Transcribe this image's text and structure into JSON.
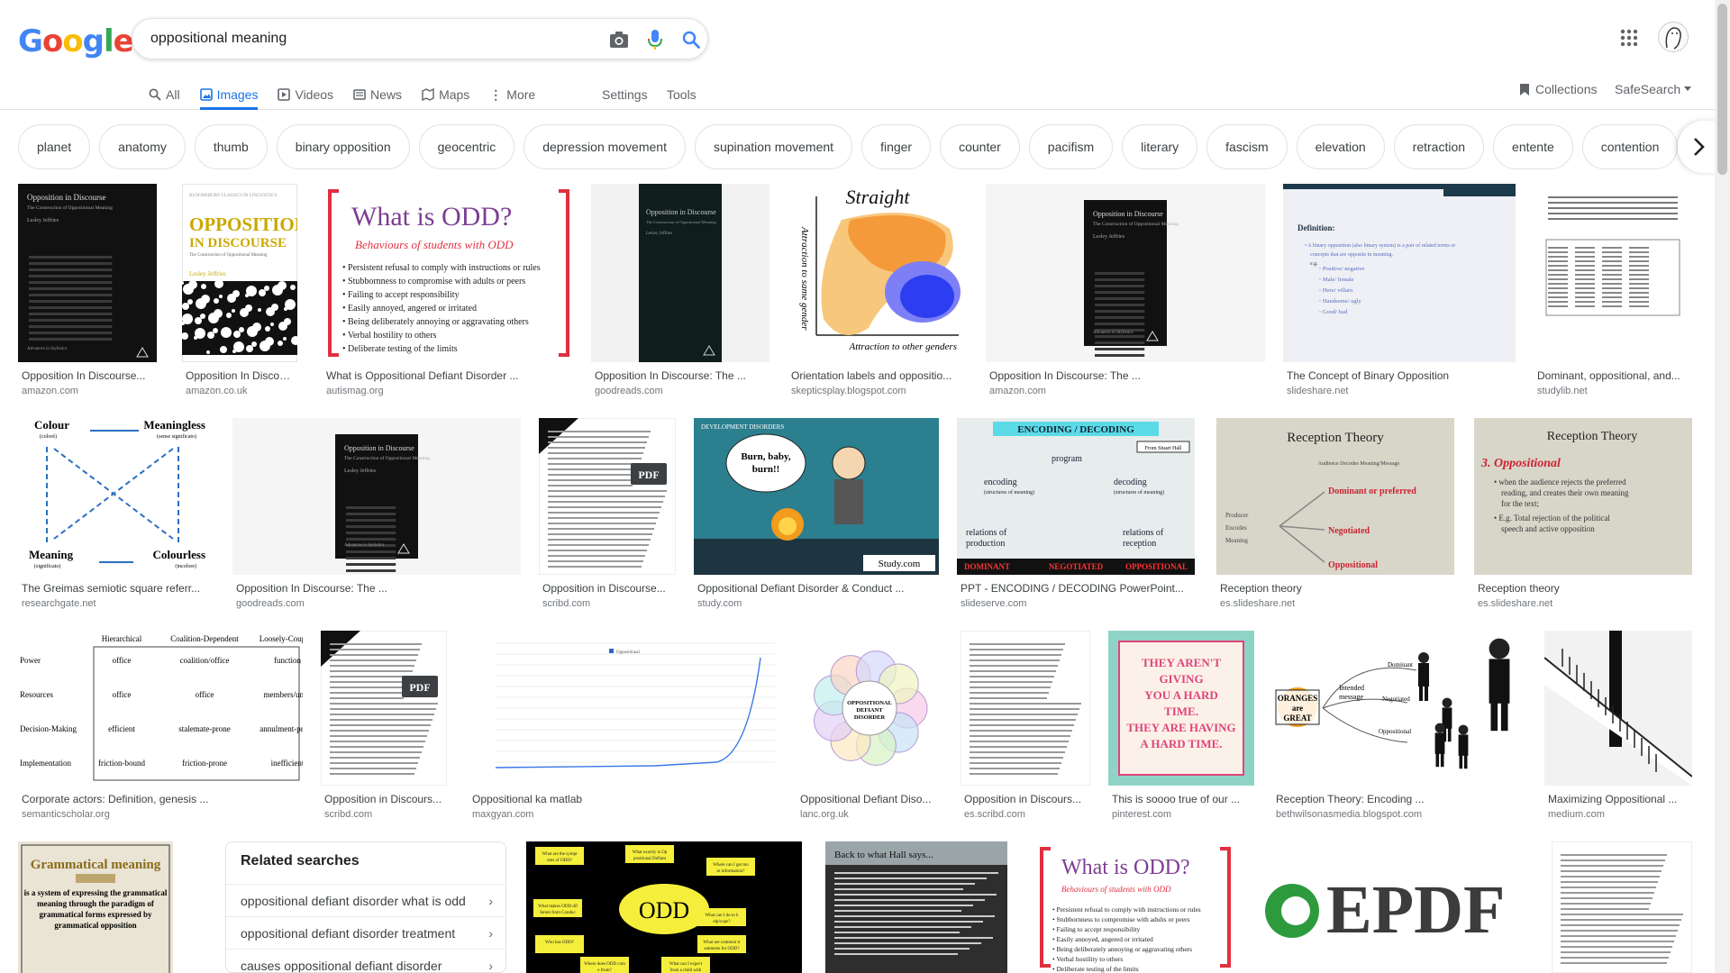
{
  "logo_letters": [
    {
      "ch": "G",
      "color": "#4285F4"
    },
    {
      "ch": "o",
      "color": "#EA4335"
    },
    {
      "ch": "o",
      "color": "#FBBC05"
    },
    {
      "ch": "g",
      "color": "#4285F4"
    },
    {
      "ch": "l",
      "color": "#34A853"
    },
    {
      "ch": "e",
      "color": "#EA4335"
    }
  ],
  "search": {
    "query": "oppositional meaning"
  },
  "tabs": {
    "all": "All",
    "images": "Images",
    "videos": "Videos",
    "news": "News",
    "maps": "Maps",
    "more": "More",
    "settings": "Settings",
    "tools": "Tools"
  },
  "right_nav": {
    "collections": "Collections",
    "safesearch": "SafeSearch"
  },
  "chips": [
    "planet",
    "anatomy",
    "thumb",
    "binary opposition",
    "geocentric",
    "depression movement",
    "supination movement",
    "finger",
    "counter",
    "pacifism",
    "literary",
    "fascism",
    "elevation",
    "retraction",
    "entente",
    "contention"
  ],
  "results": [
    {
      "title": "Opposition In Discourse...",
      "source": "amazon.com"
    },
    {
      "title": "Opposition In Discour...",
      "source": "amazon.co.uk"
    },
    {
      "title": "What is Oppositional Defiant Disorder ...",
      "source": "autismag.org"
    },
    {
      "title": "Opposition In Discourse: The ...",
      "source": "goodreads.com"
    },
    {
      "title": "Orientation labels and oppositio...",
      "source": "skepticsplay.blogspot.com"
    },
    {
      "title": "Opposition In Discourse: The ...",
      "source": "amazon.com"
    },
    {
      "title": "The Concept of Binary Opposition",
      "source": "slideshare.net"
    },
    {
      "title": "Dominant, oppositional, and...",
      "source": "studylib.net"
    },
    {
      "title": "The Greimas semiotic square referr...",
      "source": "researchgate.net"
    },
    {
      "title": "Opposition In Discourse: The ...",
      "source": "goodreads.com"
    },
    {
      "title": "Opposition in Discourse...",
      "source": "scribd.com"
    },
    {
      "title": "Oppositional Defiant Disorder & Conduct ...",
      "source": "study.com"
    },
    {
      "title": "PPT - ENCODING / DECODING PowerPoint...",
      "source": "slideserve.com"
    },
    {
      "title": "Reception theory",
      "source": "es.slideshare.net"
    },
    {
      "title": "Reception theory",
      "source": "es.slideshare.net"
    },
    {
      "title": "Corporate actors: Definition, genesis ...",
      "source": "semanticscholar.org"
    },
    {
      "title": "Opposition in Discours...",
      "source": "scribd.com"
    },
    {
      "title": "Oppositional ka matlab",
      "source": "maxgyan.com"
    },
    {
      "title": "Oppositional Defiant Diso...",
      "source": "lanc.org.uk"
    },
    {
      "title": "Opposition in Discours...",
      "source": "es.scribd.com"
    },
    {
      "title": "This is soooo true of our ...",
      "source": "pinterest.com"
    },
    {
      "title": "Reception Theory: Encoding ...",
      "source": "bethwilsonasmedia.blogspot.com"
    },
    {
      "title": "Maximizing Oppositional ...",
      "source": "medium.com"
    }
  ],
  "thumb_text": {
    "book_title": "Opposition in Discourse",
    "book_subtitle": "The Construction of Oppositional Meaning",
    "book_author": "Lesley Jeffries",
    "book_series": "Advances in Stylistics",
    "book2_series": "BLOOMSBURY CLASSICS IN LINGUISTICS",
    "book2_t1": "OPPOSITION",
    "book2_t2": "IN DISCOURSE",
    "book2_sub": "The Construction of Oppositional Meaning",
    "book2_author": "Lesley Jeffries",
    "odd_title": "What is ODD?",
    "odd_sub": "Behaviours of students with ODD",
    "odd_items": [
      "Persistent refusal to comply with instructions or rules",
      "Stubbornness to compromise with adults or peers",
      "Failing to accept responsibility",
      "Easily annoyed, angered or irritated",
      "Being deliberately annoying or aggravating others",
      "Verbal hostility to others",
      "Deliberate testing of the limits"
    ],
    "straight": "Straight",
    "attr_same": "Attraction to same gender",
    "attr_other": "Attraction to other genders",
    "definition": "Definition:",
    "def_text": "A binary opposition (also binary system) is a pair of related terms or concepts that are opposite in meaning.",
    "def_eg": "e.g.",
    "def_pairs": [
      "Positive/ negative",
      "Male/ female",
      "Hero/ villain",
      "Handsome/ ugly",
      "Good/ bad"
    ],
    "colour": "Colour",
    "colour_sub": "(coloré)",
    "meaningless": "Meaningless",
    "meaningless_sub": "(sense significato)",
    "meaning": "Meaning",
    "meaning_sub": "(significato)",
    "colourless": "Colourless",
    "colourless_sub": "(incolore)",
    "pdf": "PDF",
    "dev_disorders": "DEVELOPMENT DISORDERS",
    "burn": "Burn, baby, burn!!",
    "study": "Study.com",
    "enc_title": "ENCODING / DECODING",
    "enc_from": "From Stuart Hall",
    "enc_program": "program",
    "enc_encoding": "encoding",
    "enc_decoding": "decoding",
    "enc_struct": "(structures of meaning)",
    "enc_rel_prod": "relations of production",
    "enc_rel_rec": "relations of reception",
    "enc_dom": "DOMINANT",
    "enc_neg": "NEGOTIATED",
    "enc_opp": "OPPOSITIONAL",
    "rt_title": "Reception Theory",
    "rt_audience": "Audience Decodes Meaning/Message",
    "rt_producer": "Producer",
    "rt_encodes": "Encodes",
    "rt_meaning": "Meaning",
    "rt_dominant": "Dominant or preferred",
    "rt_negotiated": "Negotiated",
    "rt_oppositional": "Oppositional",
    "rt2_num": "3.",
    "rt2_head": "Oppositional",
    "rt2_b1": "when the audience rejects the preferred reading, and creates their own meaning for the text;",
    "rt2_b2": "E.g. Total rejection of the political speech and active opposition",
    "corp_cols": [
      "Hierarchical",
      "Coalition-Dependent",
      "Loosely-Coupled"
    ],
    "corp_rows": [
      "Power",
      "Resources",
      "Decision-Making",
      "Implementation"
    ],
    "corp_cells": [
      [
        "office",
        "coalition/office",
        "function"
      ],
      [
        "office",
        "office",
        "members/units"
      ],
      [
        "efficient",
        "stalemate-prone",
        "annulment-prone"
      ],
      [
        "friction-bound",
        "friction-prone",
        "inefficient"
      ]
    ],
    "ngram_legend": "Oppositional",
    "odd_circle": "OPPOSITIONAL DEFIANT DISORDER",
    "pin_text": [
      "THEY AREN'T",
      "GIVING",
      "YOU A HARD",
      "TIME.",
      "THEY ARE HAVING",
      "A HARD TIME."
    ],
    "oranges": "ORANGES are GREAT",
    "intended": "Intended message",
    "dominant": "Dominant",
    "negotiated": "Negotiated",
    "oppositional": "Oppositional",
    "gram_title": "Grammatical meaning",
    "gram_text": "is a system of expressing the grammatical meaning through the paradigm of grammatical forms expressed by grammatical opposition",
    "odd_center": "ODD",
    "odd_notes": [
      "What are the symptoms of ODD?",
      "What exactly is Oppositional Defiant Disorder (ODD)?",
      "Where can I get more information?",
      "What makes ODD different from Conduct Disorder (CD)?",
      "What can I do to help/cope?",
      "Who has ODD?",
      "What are common treatments for ODD?",
      "Where does ODD come from?",
      "What can I expect from a child with ODD?"
    ],
    "hall_title": "Back to what Hall says...",
    "epdf": "EPDF"
  },
  "related_searches": {
    "heading": "Related searches",
    "items": [
      "oppositional defiant disorder what is odd",
      "oppositional defiant disorder treatment",
      "causes oppositional defiant disorder"
    ]
  },
  "colors": {
    "accent": "#1a73e8",
    "odd_red": "#e1303f",
    "odd_purple": "#7c3e93"
  }
}
